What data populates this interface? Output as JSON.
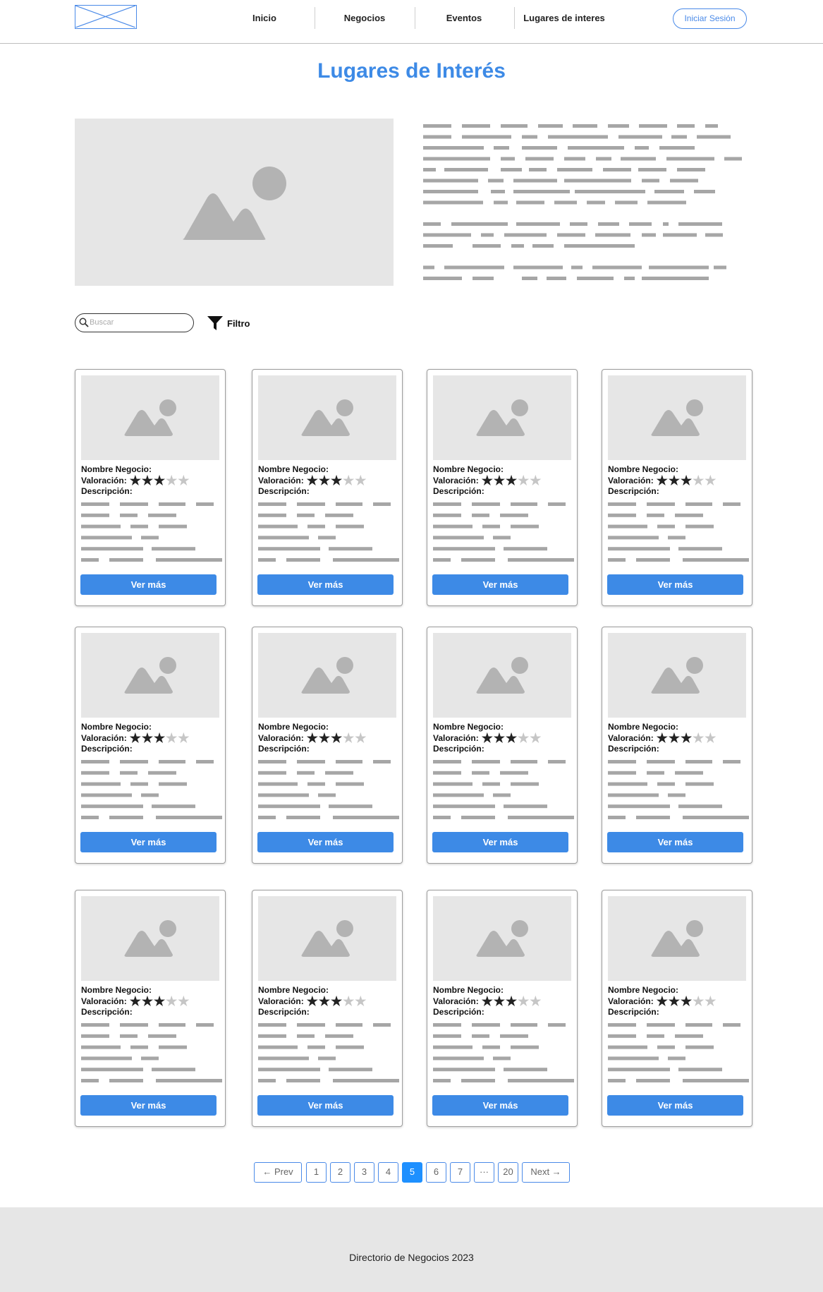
{
  "header": {
    "logo_icon": "logo-placeholder-icon",
    "nav": [
      {
        "label": "Inicio"
      },
      {
        "label": "Negocios"
      },
      {
        "label": "Eventos"
      },
      {
        "label": "Lugares de interes"
      }
    ],
    "login_label": "Iniciar Sesión"
  },
  "page": {
    "title": "Lugares de Interés",
    "hero_image_icon": "image-placeholder-icon",
    "hero_text_icon": "text-placeholder-lines"
  },
  "search": {
    "placeholder": "Buscar",
    "icon": "search-icon"
  },
  "filter": {
    "label": "Filtro",
    "icon": "funnel-icon"
  },
  "card_labels": {
    "name": "Nombre Negocio:",
    "rating": "Valoración:",
    "description": "Descripción:",
    "button": "Ver más"
  },
  "cards": [
    {
      "rating": 3,
      "max": 5
    },
    {
      "rating": 3,
      "max": 5
    },
    {
      "rating": 3,
      "max": 5
    },
    {
      "rating": 3,
      "max": 5
    },
    {
      "rating": 3,
      "max": 5
    },
    {
      "rating": 3,
      "max": 5
    },
    {
      "rating": 3,
      "max": 5
    },
    {
      "rating": 3,
      "max": 5
    },
    {
      "rating": 3,
      "max": 5
    },
    {
      "rating": 3,
      "max": 5
    },
    {
      "rating": 3,
      "max": 5
    },
    {
      "rating": 3,
      "max": 5
    }
  ],
  "pagination": {
    "prev": "← Prev",
    "pages": [
      "1",
      "2",
      "3",
      "4",
      "5",
      "6",
      "7",
      "···",
      "20"
    ],
    "current": "5",
    "next": "Next →"
  },
  "footer": {
    "text": "Directorio de Negocios 2023"
  },
  "colors": {
    "accent": "#3d8ae6",
    "active_page": "#1e90ff",
    "placeholder": "#e6e6e6",
    "placeholder_shape": "#b3b3b3"
  }
}
